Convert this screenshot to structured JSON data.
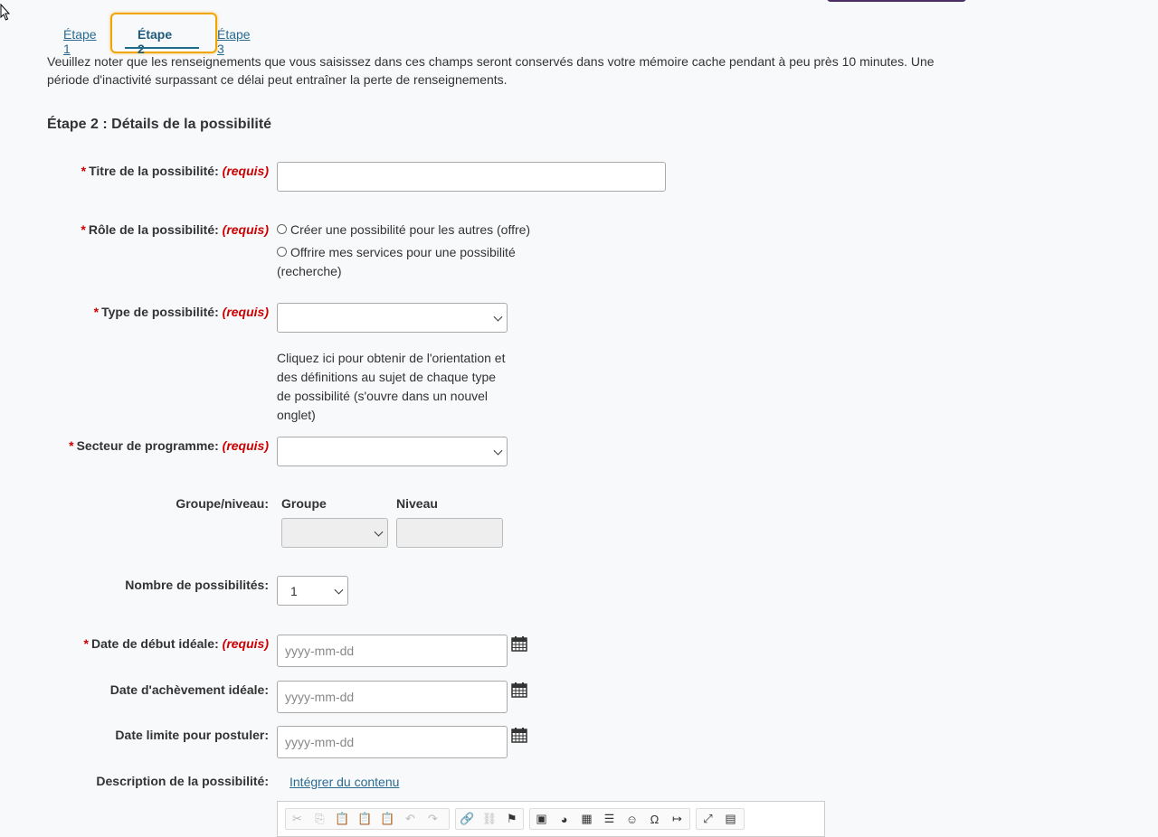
{
  "tabs": [
    {
      "label": "Étape 1"
    },
    {
      "label": "Étape 2"
    },
    {
      "label": "Étape 3"
    }
  ],
  "notice": "Veuillez noter que les renseignements que vous saisissez dans ces champs seront conservés dans votre mémoire cache pendant à peu près 10 minutes. Une période d'inactivité surpassant ce délai peut entraîner la perte de renseignements.",
  "section_title": "Étape 2 : Détails de la possibilité",
  "required_text": "(requis)",
  "required_star": "*",
  "fields": {
    "title_label": "Titre de la possibilité:",
    "role_label": "Rôle de la possibilité:",
    "role_option1": "Créer une possibilité pour les autres (offre)",
    "role_option2": "Offrire mes services pour une possibilité (recherche)",
    "type_label": "Type de possibilité:",
    "type_help": "Cliquez ici pour obtenir de l'orientation et des définitions au sujet de chaque type de possibilité (s'ouvre dans un nouvel onglet)",
    "sector_label": "Secteur de programme:",
    "group_level_label": "Groupe/niveau:",
    "group_head": "Groupe",
    "level_head": "Niveau",
    "count_label": "Nombre de possibilités:",
    "count_value": "1",
    "start_label": "Date de début idéale:",
    "end_label": "Date d'achèvement idéale:",
    "deadline_label": "Date limite pour postuler:",
    "date_placeholder": "yyyy-mm-dd",
    "description_label": "Description de la possibilité:",
    "embed_link": "Intégrer du contenu"
  },
  "icons": {
    "calendar": "calendar-icon",
    "toolbar": [
      "cut-icon",
      "copy-icon",
      "paste-icon",
      "paste-text-icon",
      "paste-word-icon",
      "undo-icon",
      "redo-icon",
      "link-icon",
      "unlink-icon",
      "anchor-icon",
      "image-icon",
      "flash-icon",
      "table-icon",
      "horizontal-rule-icon",
      "smiley-icon",
      "special-char-icon",
      "page-break-icon",
      "maximize-icon",
      "show-blocks-icon"
    ]
  },
  "colors": {
    "link": "#2a6a8e",
    "required": "#cc0000",
    "focus_ring": "#f0a500"
  }
}
